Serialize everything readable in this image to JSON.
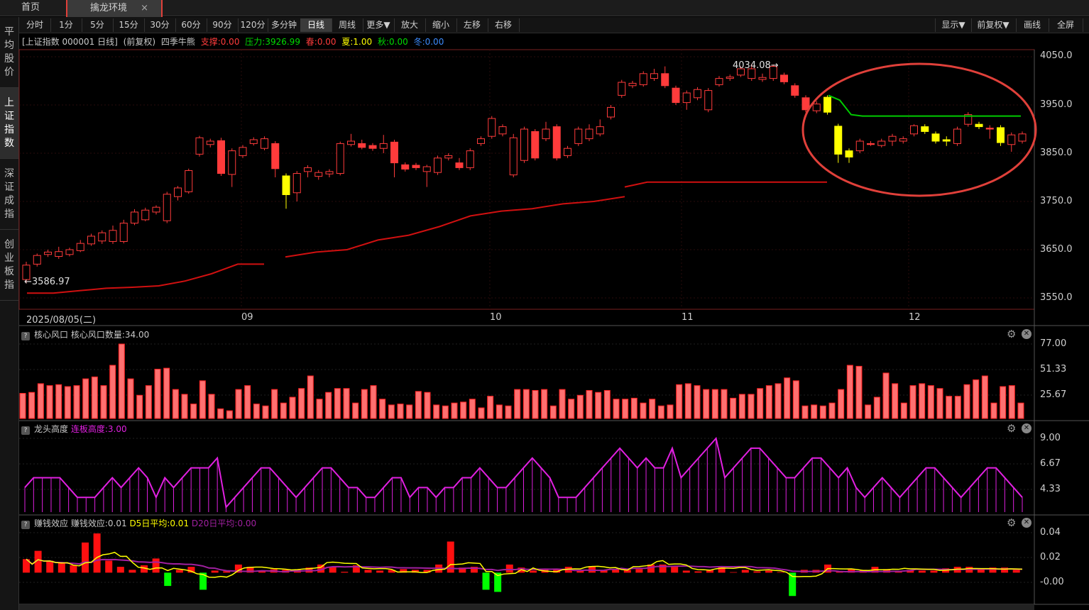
{
  "tabs": {
    "home": "首页",
    "active": "擒龙环境",
    "close_glyph": "×"
  },
  "sidebar": [
    "平均股价",
    "上证指数",
    "深证成指",
    "创业板指"
  ],
  "toolbar": {
    "periods": [
      "分时",
      "1分",
      "5分",
      "15分",
      "30分",
      "60分",
      "90分",
      "120分",
      "多分钟",
      "日线",
      "周线",
      "更多▼",
      "放大",
      "缩小",
      "左移",
      "右移"
    ],
    "active_period": "日线",
    "right": [
      "显示▼",
      "前复权▼",
      "画线",
      "全屏"
    ]
  },
  "info": {
    "security": "[上证指数 000001 日线]",
    "adjust": "(前复权)",
    "indicator": "四季牛熊",
    "support": "支撑:0.00",
    "pressure": "压力:3926.99",
    "spring": "春:0.00",
    "summer": "夏:1.00",
    "autumn": "秋:0.00",
    "winter": "冬:0.00"
  },
  "colors": {
    "up": "#ff3b3b",
    "down_yellow": "#ffff00",
    "support_line": "#d01010",
    "pressure_line": "#00cc00",
    "magenta": "#e020e0",
    "green_bar": "#00ff00",
    "highlight_circle": "#e0403a"
  },
  "main_chart": {
    "y_ticks": [
      "4050.0",
      "3950.0",
      "3850.0",
      "3750.0",
      "3650.0",
      "3550.0"
    ],
    "x_labels": [
      "2025/08/05(二)",
      "09",
      "10",
      "11",
      "12"
    ],
    "high_marker": "4034.08",
    "low_marker": "3586.97"
  },
  "panel1": {
    "name": "核心风口",
    "label": "核心风口数量:34.00",
    "y_ticks": [
      "77.00",
      "51.33",
      "25.67"
    ]
  },
  "panel2": {
    "name": "龙头高度",
    "label": "连板高度:3.00",
    "y_ticks": [
      "9.00",
      "6.67",
      "4.33"
    ]
  },
  "panel3": {
    "name": "赚钱效应",
    "label": "赚钱效应:0.01",
    "d5": "D5日平均:0.01",
    "d20": "D20日平均:0.00",
    "y_ticks": [
      "0.04",
      "0.02",
      "-0.00"
    ]
  },
  "chart_data": [
    {
      "type": "candlestick",
      "title": "[上证指数 000001 日线]",
      "ylim": [
        3550,
        4050
      ],
      "candles": [
        {
          "o": 3588,
          "c": 3618,
          "h": 3625,
          "l": 3580
        },
        {
          "o": 3620,
          "c": 3638,
          "h": 3642,
          "l": 3615
        },
        {
          "o": 3640,
          "c": 3645,
          "h": 3650,
          "l": 3635
        },
        {
          "o": 3636,
          "c": 3646,
          "h": 3656,
          "l": 3631
        },
        {
          "o": 3640,
          "c": 3650,
          "h": 3654,
          "l": 3636
        },
        {
          "o": 3648,
          "c": 3663,
          "h": 3670,
          "l": 3645
        },
        {
          "o": 3662,
          "c": 3678,
          "h": 3683,
          "l": 3658
        },
        {
          "o": 3668,
          "c": 3685,
          "h": 3690,
          "l": 3662
        },
        {
          "o": 3667,
          "c": 3690,
          "h": 3700,
          "l": 3662
        },
        {
          "o": 3667,
          "c": 3705,
          "h": 3712,
          "l": 3663
        },
        {
          "o": 3705,
          "c": 3728,
          "h": 3734,
          "l": 3701
        },
        {
          "o": 3712,
          "c": 3732,
          "h": 3737,
          "l": 3709
        },
        {
          "o": 3728,
          "c": 3738,
          "h": 3742,
          "l": 3723
        },
        {
          "o": 3710,
          "c": 3765,
          "h": 3770,
          "l": 3705
        },
        {
          "o": 3760,
          "c": 3778,
          "h": 3782,
          "l": 3752
        },
        {
          "o": 3770,
          "c": 3814,
          "h": 3818,
          "l": 3766
        },
        {
          "o": 3848,
          "c": 3882,
          "h": 3886,
          "l": 3843
        },
        {
          "o": 3868,
          "c": 3875,
          "h": 3880,
          "l": 3862
        },
        {
          "o": 3876,
          "c": 3808,
          "h": 3882,
          "l": 3803
        },
        {
          "o": 3806,
          "c": 3855,
          "h": 3860,
          "l": 3780
        },
        {
          "o": 3845,
          "c": 3862,
          "h": 3867,
          "l": 3840
        },
        {
          "o": 3870,
          "c": 3878,
          "h": 3883,
          "l": 3866
        },
        {
          "o": 3860,
          "c": 3880,
          "h": 3885,
          "l": 3856
        },
        {
          "o": 3870,
          "c": 3818,
          "h": 3875,
          "l": 3800
        },
        {
          "o": 3803,
          "c": 3764,
          "h": 3808,
          "l": 3735,
          "y": 1
        },
        {
          "o": 3768,
          "c": 3808,
          "h": 3813,
          "l": 3750
        },
        {
          "o": 3812,
          "c": 3820,
          "h": 3825,
          "l": 3800
        },
        {
          "o": 3802,
          "c": 3810,
          "h": 3815,
          "l": 3795
        },
        {
          "o": 3807,
          "c": 3812,
          "h": 3817,
          "l": 3800
        },
        {
          "o": 3808,
          "c": 3870,
          "h": 3874,
          "l": 3804
        },
        {
          "o": 3868,
          "c": 3875,
          "h": 3890,
          "l": 3864
        },
        {
          "o": 3870,
          "c": 3862,
          "h": 3878,
          "l": 3858
        },
        {
          "o": 3866,
          "c": 3860,
          "h": 3871,
          "l": 3855
        },
        {
          "o": 3860,
          "c": 3870,
          "h": 3888,
          "l": 3850
        },
        {
          "o": 3873,
          "c": 3830,
          "h": 3878,
          "l": 3800
        },
        {
          "o": 3826,
          "c": 3817,
          "h": 3831,
          "l": 3812
        },
        {
          "o": 3825,
          "c": 3820,
          "h": 3830,
          "l": 3815
        },
        {
          "o": 3812,
          "c": 3822,
          "h": 3826,
          "l": 3780
        },
        {
          "o": 3810,
          "c": 3840,
          "h": 3845,
          "l": 3805
        },
        {
          "o": 3840,
          "c": 3845,
          "h": 3850,
          "l": 3835
        },
        {
          "o": 3830,
          "c": 3820,
          "h": 3840,
          "l": 3815
        },
        {
          "o": 3820,
          "c": 3855,
          "h": 3860,
          "l": 3815
        },
        {
          "o": 3870,
          "c": 3880,
          "h": 3885,
          "l": 3865
        },
        {
          "o": 3885,
          "c": 3922,
          "h": 3927,
          "l": 3880
        },
        {
          "o": 3890,
          "c": 3905,
          "h": 3910,
          "l": 3885
        },
        {
          "o": 3805,
          "c": 3882,
          "h": 3890,
          "l": 3800
        },
        {
          "o": 3835,
          "c": 3900,
          "h": 3905,
          "l": 3830
        },
        {
          "o": 3895,
          "c": 3840,
          "h": 3900,
          "l": 3835
        },
        {
          "o": 3880,
          "c": 3900,
          "h": 3915,
          "l": 3875
        },
        {
          "o": 3905,
          "c": 3840,
          "h": 3910,
          "l": 3835
        },
        {
          "o": 3845,
          "c": 3860,
          "h": 3865,
          "l": 3840
        },
        {
          "o": 3870,
          "c": 3900,
          "h": 3905,
          "l": 3865
        },
        {
          "o": 3880,
          "c": 3900,
          "h": 3910,
          "l": 3875
        },
        {
          "o": 3890,
          "c": 3905,
          "h": 3920,
          "l": 3885
        },
        {
          "o": 3925,
          "c": 3945,
          "h": 3950,
          "l": 3920
        },
        {
          "o": 3970,
          "c": 3997,
          "h": 4002,
          "l": 3965
        },
        {
          "o": 3990,
          "c": 3995,
          "h": 4000,
          "l": 3985
        },
        {
          "o": 3992,
          "c": 4015,
          "h": 4020,
          "l": 3988
        },
        {
          "o": 4005,
          "c": 4015,
          "h": 4025,
          "l": 4000
        },
        {
          "o": 4015,
          "c": 3990,
          "h": 4030,
          "l": 3985
        },
        {
          "o": 3985,
          "c": 3955,
          "h": 3990,
          "l": 3950
        },
        {
          "o": 3955,
          "c": 3975,
          "h": 3980,
          "l": 3940
        },
        {
          "o": 3965,
          "c": 3982,
          "h": 3987,
          "l": 3960
        },
        {
          "o": 3940,
          "c": 3980,
          "h": 3985,
          "l": 3935
        },
        {
          "o": 3992,
          "c": 4005,
          "h": 4010,
          "l": 3988
        },
        {
          "o": 4005,
          "c": 4008,
          "h": 4013,
          "l": 4000
        },
        {
          "o": 4012,
          "c": 4025,
          "h": 4030,
          "l": 4008
        },
        {
          "o": 4005,
          "c": 4025,
          "h": 4035,
          "l": 4000
        },
        {
          "o": 4003,
          "c": 4007,
          "h": 4015,
          "l": 3998
        },
        {
          "o": 4005,
          "c": 4030,
          "h": 4034,
          "l": 4000
        },
        {
          "o": 4012,
          "c": 3998,
          "h": 4017,
          "l": 3993
        },
        {
          "o": 3990,
          "c": 3970,
          "h": 3995,
          "l": 3965
        },
        {
          "o": 3965,
          "c": 3940,
          "h": 3970,
          "l": 3935
        },
        {
          "o": 3938,
          "c": 3952,
          "h": 3958,
          "l": 3933
        },
        {
          "o": 3966,
          "c": 3935,
          "h": 3970,
          "l": 3930,
          "y": 1
        },
        {
          "o": 3906,
          "c": 3848,
          "h": 3911,
          "l": 3830,
          "y": 1
        },
        {
          "o": 3855,
          "c": 3842,
          "h": 3860,
          "l": 3830,
          "y": 1
        },
        {
          "o": 3855,
          "c": 3875,
          "h": 3880,
          "l": 3850
        },
        {
          "o": 3870,
          "c": 3868,
          "h": 3875,
          "l": 3865
        },
        {
          "o": 3866,
          "c": 3875,
          "h": 3880,
          "l": 3862
        },
        {
          "o": 3875,
          "c": 3885,
          "h": 3890,
          "l": 3865
        },
        {
          "o": 3875,
          "c": 3880,
          "h": 3885,
          "l": 3870
        },
        {
          "o": 3890,
          "c": 3907,
          "h": 3910,
          "l": 3885
        },
        {
          "o": 3905,
          "c": 3895,
          "h": 3910,
          "l": 3890,
          "y": 1
        },
        {
          "o": 3890,
          "c": 3875,
          "h": 3895,
          "l": 3870,
          "y": 1
        },
        {
          "o": 3878,
          "c": 3875,
          "h": 3885,
          "l": 3865,
          "y": 1
        },
        {
          "o": 3870,
          "c": 3900,
          "h": 3905,
          "l": 3865
        },
        {
          "o": 3910,
          "c": 3930,
          "h": 3935,
          "l": 3905
        },
        {
          "o": 3910,
          "c": 3905,
          "h": 3915,
          "l": 3900,
          "y": 1
        },
        {
          "o": 3902,
          "c": 3900,
          "h": 3908,
          "l": 3880
        },
        {
          "o": 3903,
          "c": 3872,
          "h": 3908,
          "l": 3865,
          "y": 1
        },
        {
          "o": 3868,
          "c": 3888,
          "h": 3893,
          "l": 3853
        },
        {
          "o": 3875,
          "c": 3890,
          "h": 3895,
          "l": 3870
        }
      ],
      "support_line": [
        3560,
        3560,
        3565,
        3570,
        3572,
        3575,
        3585,
        3600,
        3620,
        3620,
        3635,
        3645,
        3650,
        3670,
        3680,
        3698,
        3720,
        3730,
        3735,
        3745,
        3750,
        3760,
        3780,
        3790,
        3790,
        3790,
        3790,
        3790,
        3790,
        3790,
        3790,
        3790
      ],
      "pressure_line": [
        3970,
        3960,
        3930,
        3926.99,
        3926.99,
        3926.99,
        3926.99,
        3926.99,
        3926.99,
        3926.99,
        3926.99,
        3926.99,
        3926.99,
        3926.99,
        3926.99,
        3926.99,
        3926.99,
        3926.99
      ]
    },
    {
      "type": "bar",
      "title": "核心风口",
      "ylim": [
        0,
        77
      ],
      "values": [
        26,
        27,
        36,
        34,
        35,
        33,
        34,
        41,
        43,
        34,
        55,
        77,
        41,
        24,
        34,
        51,
        52,
        30,
        25,
        15,
        39,
        25,
        10,
        8,
        30,
        34,
        15,
        13,
        30,
        16,
        22,
        31,
        44,
        20,
        27,
        31,
        31,
        16,
        30,
        34,
        20,
        14,
        15,
        14,
        28,
        27,
        14,
        13,
        16,
        17,
        20,
        11,
        23,
        14,
        13,
        30,
        30,
        29,
        30,
        13,
        30,
        20,
        24,
        29,
        27,
        29,
        20,
        20,
        21,
        16,
        20,
        13,
        14,
        35,
        36,
        34,
        30,
        30,
        30,
        21,
        25,
        25,
        31,
        34,
        36,
        42,
        39,
        13,
        14,
        13,
        16,
        30,
        55,
        54,
        14,
        22,
        47,
        36,
        16,
        34,
        36,
        34,
        31,
        23,
        23,
        35,
        40,
        44,
        16,
        33,
        34,
        16
      ],
      "ytick_values": [
        77,
        51.33,
        25.67
      ]
    },
    {
      "type": "line",
      "title": "龙头高度",
      "ylim": [
        1.5,
        9
      ],
      "values": [
        4,
        5,
        5,
        5,
        5,
        4,
        3,
        3,
        3,
        4,
        5,
        4,
        5,
        6,
        5,
        3,
        5,
        4,
        5,
        6,
        6,
        6,
        7,
        2,
        3,
        4,
        5,
        6,
        6,
        5,
        4,
        3,
        4,
        5,
        6,
        6,
        5,
        4,
        4,
        3,
        3,
        4,
        5,
        5,
        3,
        4,
        4,
        3,
        4,
        4,
        5,
        5,
        6,
        5,
        4,
        4,
        5,
        6,
        7,
        6,
        5,
        3,
        3,
        3,
        4,
        5,
        6,
        7,
        8,
        7,
        6,
        7,
        6,
        6,
        8,
        5,
        6,
        7,
        8,
        9,
        5,
        6,
        7,
        8,
        8,
        7,
        6,
        5,
        5,
        6,
        7,
        7,
        6,
        5,
        6,
        4,
        3,
        4,
        5,
        4,
        3,
        4,
        5,
        6,
        6,
        5,
        4,
        3,
        4,
        5,
        6,
        6,
        5,
        4,
        3
      ]
    },
    {
      "type": "bar",
      "title": "赚钱效应",
      "ylim": [
        -0.025,
        0.04
      ],
      "values": [
        0.0155,
        0.0063,
        0.0232,
        0.0098,
        0.0141,
        0.0056,
        0.0125,
        0.0077,
        0.0098,
        0.0063,
        0.0309,
        0.0084,
        0.0393,
        0.0226,
        0.0141,
        0.0155,
        0.0084,
        0.0091,
        0.0056,
        -0.0045,
        0.0098,
        0.0077,
        0.0161,
        0.0098,
        -0.0093,
        0.0077,
        0.0056,
        0.0035,
        0.0084,
        -0.0045,
        -0.0128,
        -0.0072,
        0.0049,
        0.0084,
        0.0043,
        0.0098,
        0.0105,
        0.0063,
        0.0084,
        0.0098,
        0.0042,
        0.0056,
        0.0061,
        0.0056,
        0.0056,
        0.0063,
        0.0056,
        0.0091,
        0.0077,
        0.0091,
        0.0105,
        0.0318,
        0.0084,
        0.0063,
        0.0038,
        0.0084,
        0.0098,
        0.0077,
        0.0056,
        0.0042,
        0.0049,
        0.0084,
        0.0056,
        -0.0072,
        0.0063,
        0.0042,
        0.0056,
        0.0042,
        0.0056,
        0.0049,
        0.0105,
        0.0063,
        0.0318,
        0.0049,
        0.0077,
        0.0119,
        0.0084,
        0.0042,
        -0.0128,
        0.0049,
        -0.0148,
        0.0204,
        0.0105,
        0.0063,
        0.0077,
        -0.0058,
        0.0049,
        0.0084,
        0.0056,
        0.0042,
        0.0056,
        0.0056,
        0.0084,
        0.0098,
        0.0049,
        0.0148,
        0.0091,
        0.0063,
        0.0056,
        0.0042,
        0.0063,
        0.0042,
        0.0056,
        0.0255,
        0.0063,
        0.0077,
        0.0105,
        0.0242,
        0.0105,
        0.0049,
        0.0084,
        0.0077,
        0.0049,
        0.0049,
        0.0042,
        0.0042,
        0.0056,
        0.0155,
        0.0091,
        0.0042,
        0.0035,
        0.0084,
        0.0056,
        0.0049,
        0.0042,
        0.0063,
        0.0049,
        0.0049,
        0.0035,
        -0.0037,
        -0.0186,
        0.0049,
        0.0056,
        0.0049,
        0.0056,
        0.0091,
        0.0105,
        0.0049,
        0.0042,
        0.0042,
        0.0063,
        0.0049,
        0.0056,
        0.0049,
        0.0084,
        0.0042,
        0.0063,
        0.0077,
        0.0049,
        0.0105,
        0.0056,
        0.0042,
        0.0049,
        0.0063,
        0.0049,
        0.0049,
        0.007,
        0.0063,
        0.0084,
        0.0063,
        0.0084,
        0.0049,
        0.0063,
        0.0063,
        0.0077,
        0.0049,
        0.0077,
        0.0063,
        0.0056,
        0.0049
      ],
      "ytick_values": [
        0.04,
        0.02,
        0
      ]
    }
  ]
}
